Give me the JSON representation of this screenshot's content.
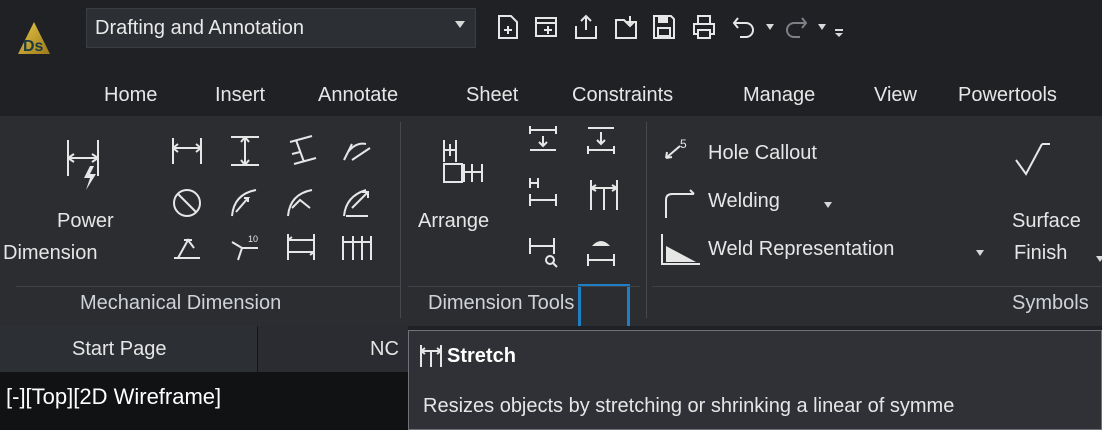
{
  "app": {
    "workspace": "Drafting and Annotation",
    "logo_text": "Ds"
  },
  "quick_access": {
    "icons": [
      "new-sheet-icon",
      "new-drawing-icon",
      "export-icon",
      "import-icon",
      "save-icon",
      "print-icon",
      "undo-icon",
      "redo-icon",
      "customize-icon"
    ]
  },
  "ribbon_tabs": [
    "Home",
    "Insert",
    "Annotate",
    "Sheet",
    "Constraints",
    "Manage",
    "View",
    "Powertools"
  ],
  "groups": {
    "mechanical": {
      "label": "Mechanical Dimension",
      "power_dimension_line1": "Power",
      "power_dimension_line2": "Dimension"
    },
    "dimension_tools": {
      "label": "Dimension Tools",
      "arrange": "Arrange"
    },
    "symbols": {
      "label": "Symbols",
      "hole_callout": "Hole Callout",
      "welding": "Welding",
      "weld_representation": "Weld Representation",
      "surface_finish_line1": "Surface",
      "surface_finish_line2": "Finish"
    }
  },
  "doc_tabs": {
    "start_page": "Start Page",
    "second": "NC"
  },
  "viewport": {
    "label": "[-][Top][2D Wireframe]"
  },
  "tooltip": {
    "title": "Stretch",
    "description": "Resizes objects by stretching or shrinking a linear of symme"
  },
  "colors": {
    "accent": "#1e7fc4",
    "ribbon_bg": "#2b2d31",
    "bar_bg": "#1f2124"
  }
}
